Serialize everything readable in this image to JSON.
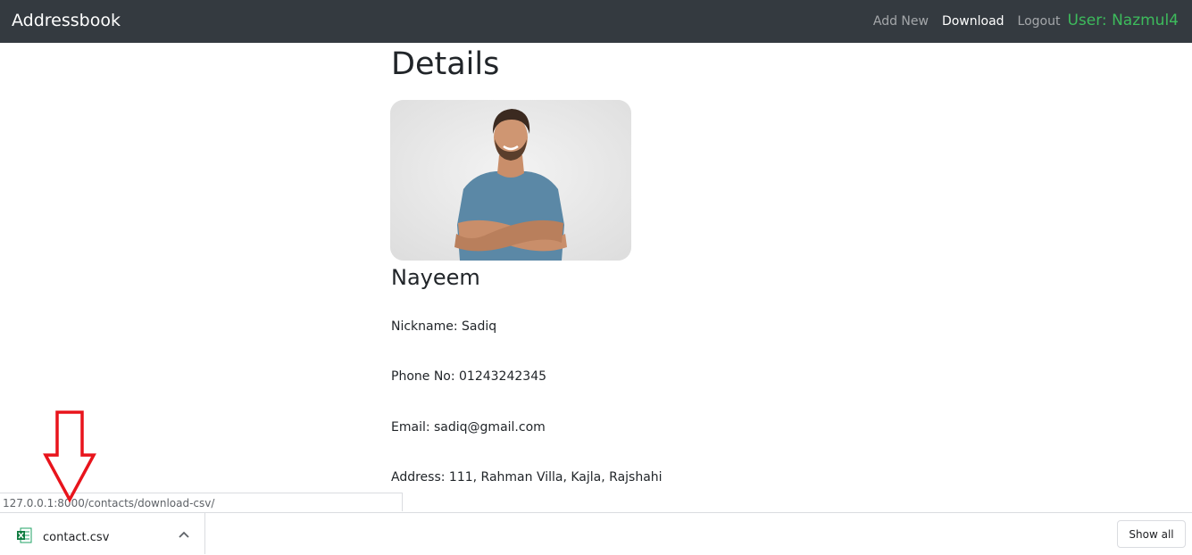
{
  "navbar": {
    "brand": "Addressbook",
    "links": [
      "Add New",
      "Download",
      "Logout"
    ],
    "user": "User: Nazmul4"
  },
  "main": {
    "title": "Details",
    "name": "Nayeem",
    "fields": [
      "Nickname: Sadiq",
      "Phone No: 01243242345",
      "Email: sadiq@gmail.com",
      "Address: 111, Rahman Villa, Kajla, Rajshahi"
    ]
  },
  "status_bar": {
    "url": "127.0.0.1:8000/contacts/download-csv/"
  },
  "download_bar": {
    "file_name": "contact.csv",
    "file_icon": "excel-file-icon",
    "show_all_label": "Show all"
  },
  "annotation": {
    "icon": "arrow-down-icon",
    "color": "#e8141c"
  },
  "colors": {
    "navbar_bg": "#343a40",
    "user_green": "#3dbb5c"
  }
}
